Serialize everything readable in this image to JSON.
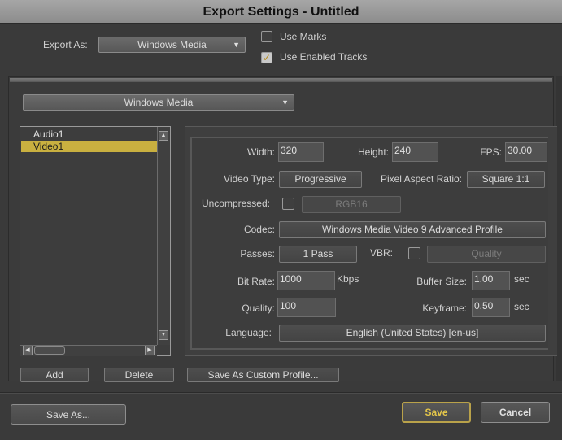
{
  "window": {
    "title": "Export Settings - Untitled"
  },
  "top": {
    "export_as_label": "Export As:",
    "export_as_value": "Windows Media",
    "use_marks_label": "Use Marks",
    "use_marks_checked": false,
    "use_enabled_tracks_label": "Use Enabled Tracks",
    "use_enabled_tracks_checked": true
  },
  "format_dropdown": {
    "value": "Windows Media"
  },
  "tracks": {
    "items": [
      {
        "label": "Audio1",
        "selected": false
      },
      {
        "label": "Video1",
        "selected": true
      }
    ],
    "add_label": "Add",
    "delete_label": "Delete"
  },
  "settings": {
    "width_label": "Width:",
    "width_value": "320",
    "height_label": "Height:",
    "height_value": "240",
    "fps_label": "FPS:",
    "fps_value": "30.00",
    "video_type_label": "Video Type:",
    "video_type_value": "Progressive",
    "pixel_aspect_label": "Pixel Aspect Ratio:",
    "pixel_aspect_value": "Square 1:1",
    "uncompressed_label": "Uncompressed:",
    "uncompressed_checked": false,
    "uncompressed_format": "RGB16",
    "codec_label": "Codec:",
    "codec_value": "Windows Media Video 9 Advanced Profile",
    "passes_label": "Passes:",
    "passes_value": "1 Pass",
    "vbr_label": "VBR:",
    "vbr_checked": false,
    "vbr_mode": "Quality",
    "bitrate_label": "Bit Rate:",
    "bitrate_value": "1000",
    "bitrate_unit": "Kbps",
    "buffer_label": "Buffer Size:",
    "buffer_value": "1.00",
    "buffer_unit": "sec",
    "quality_label": "Quality:",
    "quality_value": "100",
    "keyframe_label": "Keyframe:",
    "keyframe_value": "0.50",
    "keyframe_unit": "sec",
    "language_label": "Language:",
    "language_value": "English (United States) [en-us]",
    "save_custom_label": "Save As Custom Profile..."
  },
  "footer": {
    "save_as_label": "Save As...",
    "save_label": "Save",
    "cancel_label": "Cancel"
  },
  "colors": {
    "selection": "#c9b040",
    "save_accent": "#e4c64a",
    "check_accent": "#b88c18"
  }
}
